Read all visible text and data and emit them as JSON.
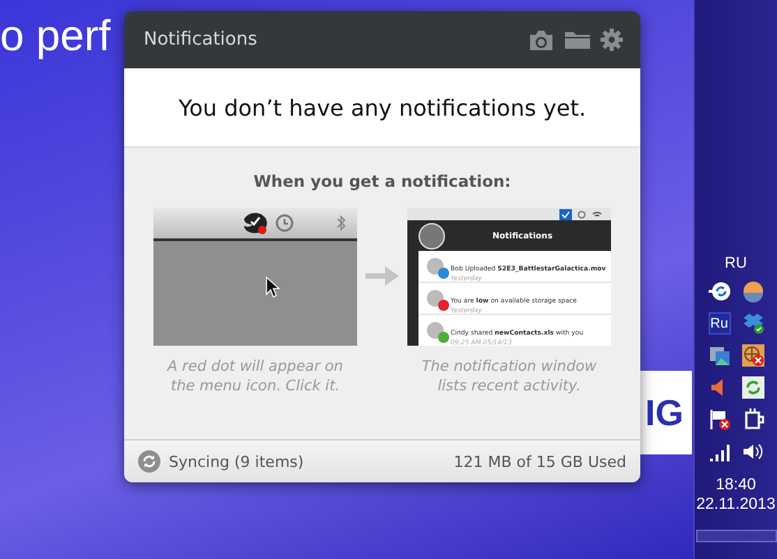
{
  "wallpaper": {
    "slogan": "o perf",
    "logo": "IG"
  },
  "window": {
    "title": "Notifications",
    "message": "You don’t have any notifications yet.",
    "heading": "When you get a notification:",
    "steps": [
      {
        "kind": "menubar",
        "caption": "A red dot will appear on the menu icon. Click it."
      },
      {
        "kind": "popup",
        "caption": "The notification window lists recent activity.",
        "preview": {
          "title": "Notifications",
          "items": [
            {
              "text": "Bob Uploaded **S2E3_BattlestarGalactica.mov**",
              "time": "Yesterday",
              "color": "#2b8ad6"
            },
            {
              "text": "You are **low** on available storage space",
              "time": "Yesterday",
              "color": "#e0262b"
            },
            {
              "text": "Cindy shared **newContacts.xls** with you",
              "time": "09:25 AM 05/14/13",
              "color": "#4caf3a"
            }
          ]
        }
      }
    ],
    "status": {
      "sync": "Syncing (9 items)",
      "usage": "121 MB of 15 GB Used"
    }
  },
  "tray": {
    "language": "RU",
    "keyboard": "Ru",
    "time": "18:40",
    "date": "22.11.2013"
  }
}
